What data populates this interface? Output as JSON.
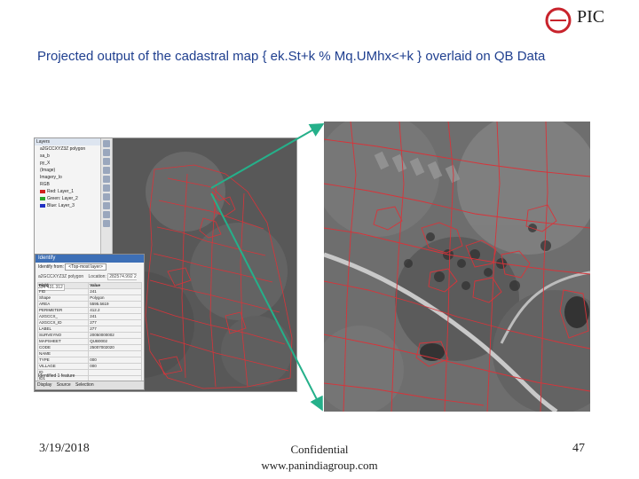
{
  "brand": {
    "name": "PIC"
  },
  "slide": {
    "title": "Projected output  of the  cadastral map { ek.St+k % Mq.UMhx<+k } overlaid on QB Data"
  },
  "gis_window": {
    "layers_header": "Layers",
    "layers": [
      "a2GCCXYZ3Z polygon",
      "sa_b",
      "py_X",
      "(Image)",
      "Imagery_lo",
      "RGB",
      "Red:  Layer_1",
      "Green: Layer_2",
      "Blue:  Layer_3"
    ],
    "identify": {
      "title": "Identify",
      "identify_from_label": "Identify from:",
      "identify_from_value": "<Top-most layer>",
      "location_label": "Location:",
      "location_value": "282574.992  2 354 431.312",
      "tree_item": "a2GCCXYZ3Z polygon",
      "table_headers": [
        "Field",
        "Value"
      ],
      "rows": [
        [
          "FID",
          "241"
        ],
        [
          "Shape",
          "Polygon"
        ],
        [
          "AREA",
          "5595.5619"
        ],
        [
          "PERIMETER",
          "412.2"
        ],
        [
          "A2GCCX_",
          "241"
        ],
        [
          "A2GCCX_ID",
          "277"
        ],
        [
          "LABEL",
          "277"
        ],
        [
          "SURVEYNO",
          "20050000002"
        ],
        [
          "MAPSHEET",
          "QUB0002"
        ],
        [
          "CODE",
          "25007002020"
        ],
        [
          "NAME",
          ""
        ],
        [
          "TYPE",
          "000"
        ],
        [
          "VILLAGE",
          "000"
        ],
        [
          "ID",
          ""
        ],
        [
          "ID1",
          ""
        ],
        [
          "KM_NO",
          "NA"
        ]
      ],
      "footer": "Identified 1 feature",
      "tabs": [
        "Display",
        "Source",
        "Selection"
      ]
    }
  },
  "footer": {
    "date": "3/19/2018",
    "center_line1": "Confidential",
    "center_line2": "www.panindiagroup.com",
    "page": "47"
  },
  "colors": {
    "title": "#1f3f8f",
    "overlay_red": "#d8343a",
    "arrow": "#25b08a",
    "brand_red": "#c8232c"
  }
}
